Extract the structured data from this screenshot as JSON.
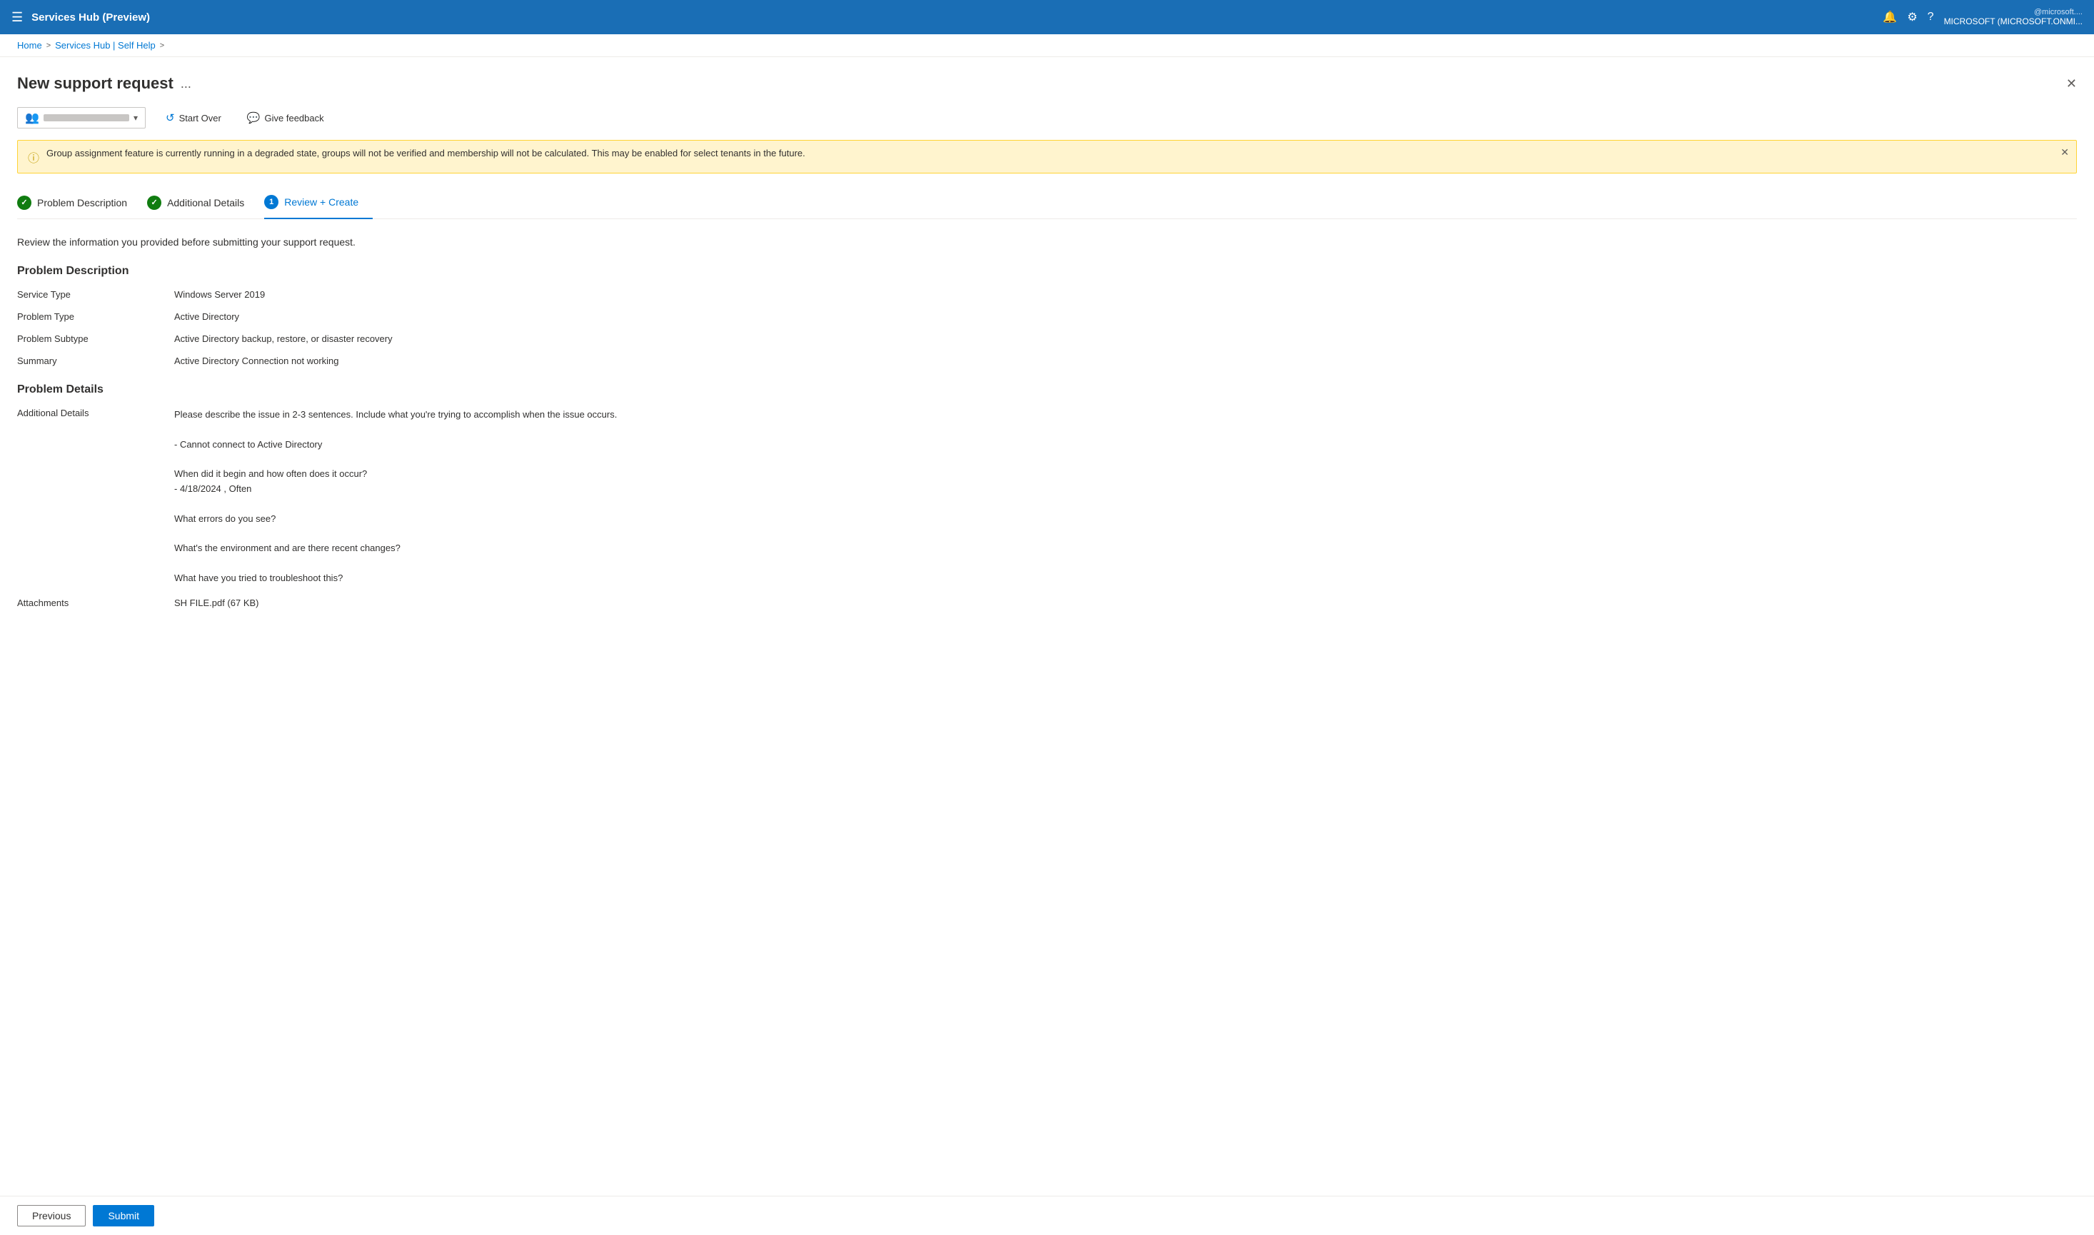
{
  "topbar": {
    "hamburger": "☰",
    "title": "Services Hub (Preview)",
    "icons": {
      "bell": "🔔",
      "gear": "⚙",
      "help": "?"
    },
    "user": {
      "email_partial": "@microsoft....",
      "tenant": "MICROSOFT (MICROSOFT.ONMI..."
    }
  },
  "breadcrumb": {
    "home": "Home",
    "separator1": ">",
    "link": "Services Hub | Self Help",
    "separator2": ">",
    "current": ""
  },
  "page": {
    "title": "New support request",
    "dots": "...",
    "close_btn": "✕"
  },
  "toolbar": {
    "start_over_label": "Start Over",
    "give_feedback_label": "Give feedback"
  },
  "warning_banner": {
    "text": "Group assignment feature is currently running in a degraded state, groups will not be verified and membership will not be calculated. This may be enabled for select tenants in the future.",
    "close": "✕"
  },
  "steps": [
    {
      "id": "problem-description",
      "label": "Problem Description",
      "state": "completed",
      "number": "✓"
    },
    {
      "id": "additional-details",
      "label": "Additional Details",
      "state": "completed",
      "number": "✓"
    },
    {
      "id": "review-create",
      "label": "Review + Create",
      "state": "active",
      "number": "1"
    }
  ],
  "review": {
    "intro": "Review the information you provided before submitting your support request.",
    "problem_description_heading": "Problem Description",
    "fields": [
      {
        "label": "Service Type",
        "value": "Windows Server 2019"
      },
      {
        "label": "Problem Type",
        "value": "Active Directory"
      },
      {
        "label": "Problem Subtype",
        "value": "Active Directory backup, restore, or disaster recovery"
      },
      {
        "label": "Summary",
        "value": "Active Directory Connection not working"
      }
    ],
    "problem_details_heading": "Problem Details",
    "additional_details_label": "Additional Details",
    "additional_details_lines": [
      "Please describe the issue in 2-3 sentences. Include what you're trying to accomplish when the issue occurs.",
      "",
      "- Cannot connect to Active Directory",
      "",
      "When did it begin and how often does it occur?",
      "- 4/18/2024 , Often",
      "",
      "What errors do you see?",
      "",
      "What's the environment and are there recent changes?",
      "",
      "What have you tried to troubleshoot this?"
    ],
    "attachments_label": "Attachments",
    "attachments_value": "SH FILE.pdf (67 KB)"
  },
  "buttons": {
    "previous": "Previous",
    "submit": "Submit"
  }
}
